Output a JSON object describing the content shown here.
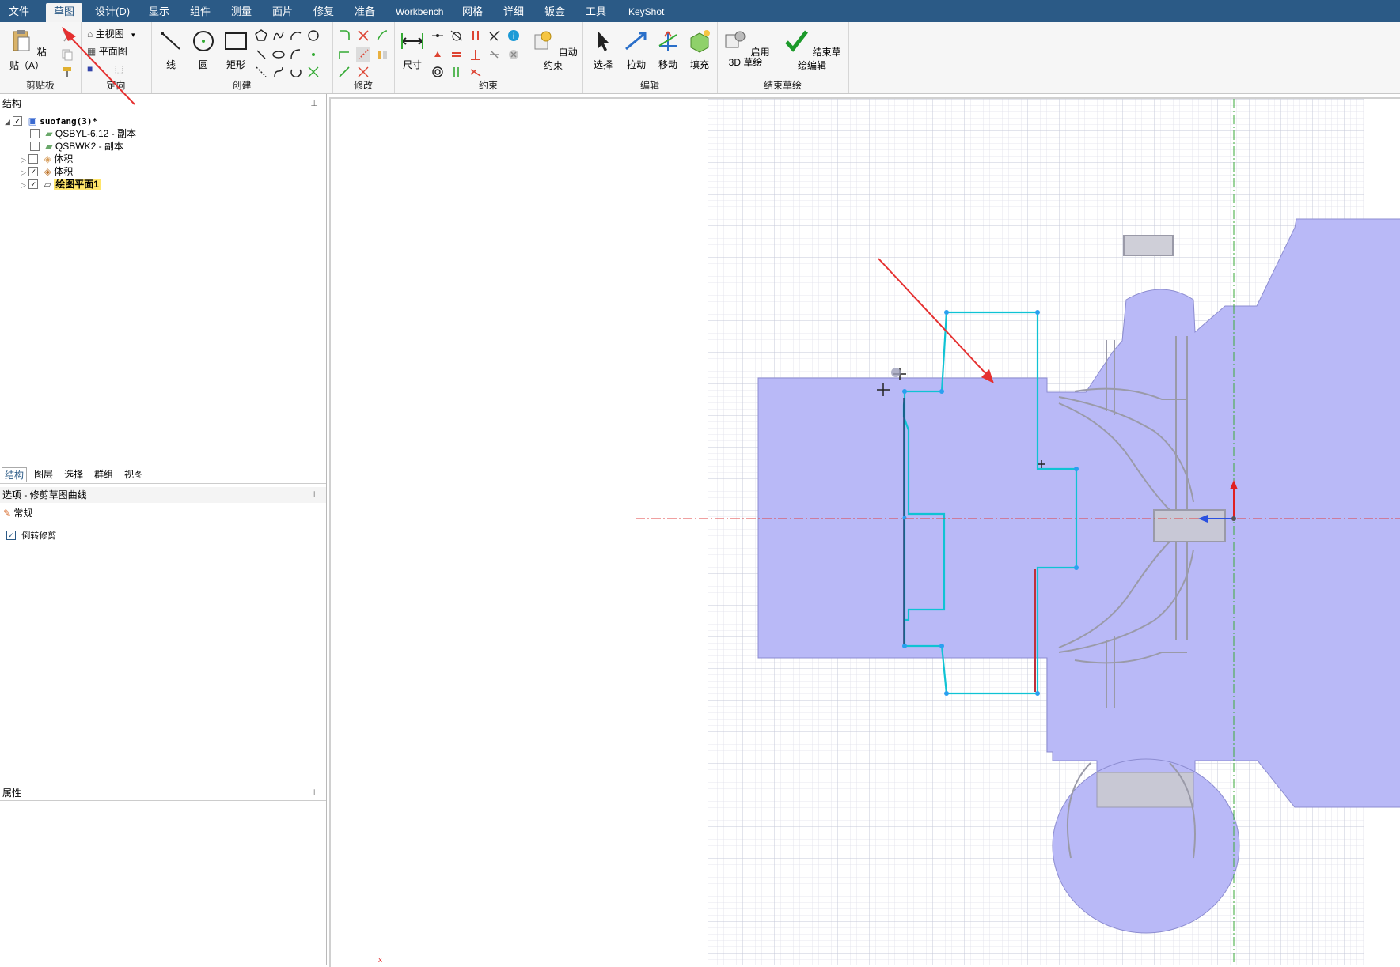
{
  "menu": {
    "items": [
      "文件",
      "草图",
      "设计(D)",
      "显示",
      "组件",
      "测量",
      "面片",
      "修复",
      "准备",
      "Workbench",
      "网格",
      "详细",
      "钣金",
      "工具",
      "KeyShot"
    ],
    "active": "草图"
  },
  "ribbon": {
    "clipboard": {
      "paste": "粘贴（A）",
      "label": "剪贴板"
    },
    "orient": {
      "home_view": "主视图",
      "plan_view": "平面图",
      "label": "定向"
    },
    "create": {
      "line": "线",
      "circle": "圆",
      "rect": "矩形",
      "label": "创建"
    },
    "modify": {
      "label": "修改"
    },
    "constraint": {
      "dimension": "尺寸",
      "auto": "自动约束",
      "label": "约束"
    },
    "edit": {
      "select": "选择",
      "pull": "拉动",
      "move": "移动",
      "fill": "填充",
      "label": "编辑"
    },
    "finish": {
      "enable3d": "启用 3D 草绘",
      "finish_edit": "结束草绘编辑",
      "label": "结束草绘"
    }
  },
  "structure": {
    "title": "结构",
    "tree": [
      {
        "label": "suofang(3)*",
        "checked": true,
        "level": 0
      },
      {
        "label": "QSBYL-6.12 - 副本",
        "checked": false,
        "level": 1
      },
      {
        "label": "QSBWK2 - 副本",
        "checked": false,
        "level": 1
      },
      {
        "label": "体积",
        "checked": false,
        "level": 1
      },
      {
        "label": "体积",
        "checked": true,
        "level": 1
      },
      {
        "label": "绘图平面1",
        "checked": true,
        "level": 1
      }
    ]
  },
  "tabs": [
    "结构",
    "图层",
    "选择",
    "群组",
    "视图"
  ],
  "options": {
    "title": "选项 - 修剪草图曲线",
    "section": "常规",
    "invert_trim": "倒转修剪",
    "invert_trim_checked": true
  },
  "properties": {
    "title": "属性"
  },
  "colors": {
    "menubar": "#2b5a86",
    "body_fill": "#b9b9f7",
    "sketch_line": "#00b8c8",
    "arrow": "#e53030"
  }
}
